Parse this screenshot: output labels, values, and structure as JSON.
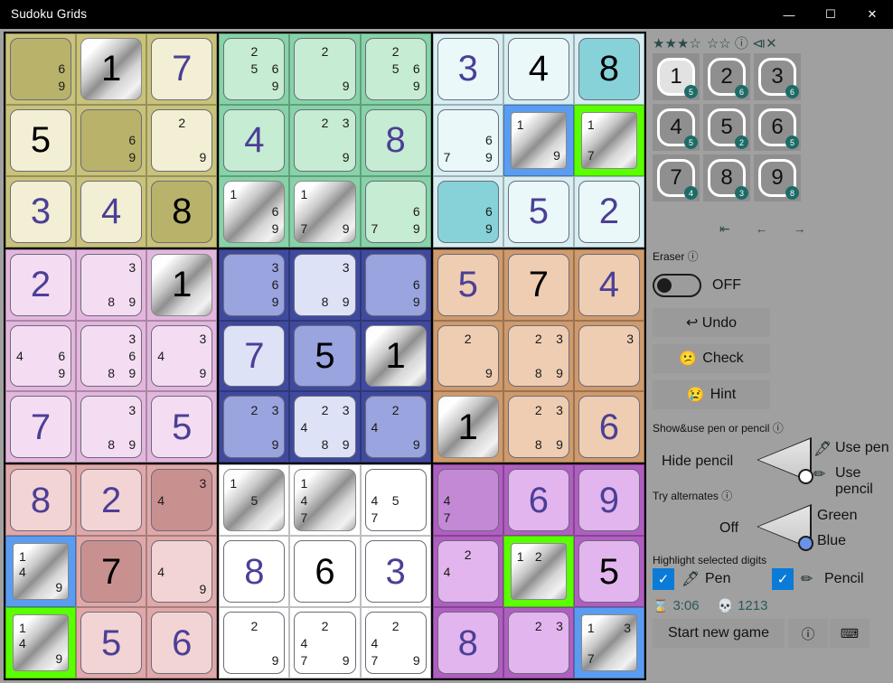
{
  "window": {
    "title": "Sudoku Grids",
    "minimize": "—",
    "maximize": "☐",
    "close": "✕"
  },
  "panel": {
    "rating": "★★★☆",
    "rating2": "☆☆",
    "info_icon": "ⓘ",
    "mute_icon": "⧏✕",
    "nav": "⇤ ← →",
    "eraser_label": "Eraser ⓘ",
    "eraser_state": "OFF",
    "undo_label": "↩ Undo",
    "check_label": "Check",
    "check_icon": "😕",
    "hint_label": "Hint",
    "hint_icon": "😢",
    "pen_section_label": "Show&use pen or pencil ⓘ",
    "hide_pencil_label": "Hide pencil",
    "use_pen_label": "Use pen",
    "use_pencil_label": "Use pencil",
    "pen_icon": "🖋",
    "pencil_icon": "✏",
    "alternates_label": "Try alternates ⓘ",
    "alt_off_label": "Off",
    "alt_green_label": "Green",
    "alt_blue_label": "Blue",
    "highlight_label": "Highlight selected digits",
    "check_mark": "✓",
    "hl_pen_label": "Pen",
    "hl_pencil_label": "Pencil",
    "timer_icon": "⌛",
    "timer_value": "3:06",
    "score_icon": "💀",
    "score_value": "1213",
    "new_game_label": "Start new game",
    "info2_icon": "ⓘ",
    "keyboard_icon": "⌨",
    "numpad": [
      {
        "digit": "1",
        "count": "5",
        "active": true
      },
      {
        "digit": "2",
        "count": "6",
        "active": false
      },
      {
        "digit": "3",
        "count": "6",
        "active": false
      },
      {
        "digit": "4",
        "count": "5",
        "active": false
      },
      {
        "digit": "5",
        "count": "2",
        "active": false
      },
      {
        "digit": "6",
        "count": "5",
        "active": false
      },
      {
        "digit": "7",
        "count": "4",
        "active": false
      },
      {
        "digit": "8",
        "count": "3",
        "active": false
      },
      {
        "digit": "9",
        "count": "8",
        "active": false
      }
    ]
  },
  "board": {
    "block_colors": [
      {
        "bg": "#c9c27a",
        "cell": "#f2efd4",
        "dark": "#b9b26a"
      },
      {
        "bg": "#86d3a8",
        "cell": "#c6ecd3",
        "dark": "#6cc292"
      },
      {
        "bg": "#d6eef2",
        "cell": "#eaf8fa",
        "dark": "#86d2d8"
      },
      {
        "bg": "#e3b6de",
        "cell": "#f4ddf2",
        "dark": "#d9a3d4"
      },
      {
        "bg": "#3f4a9e",
        "cell": "#dee2f7",
        "dark": "#9aa4de"
      },
      {
        "bg": "#cf9a6c",
        "cell": "#eecdb2",
        "dark": "#e3bb9c"
      },
      {
        "bg": "#e0a8a8",
        "cell": "#f3d4d4",
        "dark": "#c99090"
      },
      {
        "bg": "#ffffff",
        "cell": "#ffffff",
        "dark": "#ececec"
      },
      {
        "bg": "#b05ec2",
        "cell": "#e3b5ee",
        "dark": "#c389d4"
      }
    ],
    "cells": [
      [
        {
          "pencil": [
            null,
            null,
            null,
            null,
            null,
            "6",
            null,
            null,
            "9"
          ],
          "shade": "dark"
        },
        {
          "value": "1",
          "style": "metal"
        },
        {
          "value": "7",
          "style": "pen"
        },
        {
          "value": "5",
          "style": "given"
        },
        {
          "pencil": [
            null,
            null,
            null,
            null,
            null,
            "6",
            null,
            null,
            "9"
          ],
          "shade": "dark"
        },
        {
          "pencil": [
            null,
            "2",
            null,
            null,
            null,
            null,
            null,
            null,
            "9"
          ]
        },
        {
          "value": "3",
          "style": "pen"
        },
        {
          "value": "4",
          "style": "pen"
        },
        {
          "value": "8",
          "style": "given",
          "shade": "dark"
        }
      ],
      [
        {
          "pencil": [
            null,
            "2",
            null,
            null,
            "5",
            "6",
            null,
            null,
            "9"
          ]
        },
        {
          "pencil": [
            null,
            "2",
            null,
            null,
            null,
            null,
            null,
            null,
            "9"
          ]
        },
        {
          "pencil": [
            null,
            "2",
            null,
            null,
            "5",
            "6",
            null,
            null,
            "9"
          ]
        },
        {
          "value": "4",
          "style": "pen"
        },
        {
          "pencil": [
            null,
            "2",
            "3",
            null,
            null,
            null,
            null,
            null,
            "9"
          ]
        },
        {
          "value": "8",
          "style": "pen"
        },
        {
          "pencil": [
            "1",
            null,
            null,
            null,
            null,
            "6",
            null,
            null,
            "9"
          ],
          "style": "metal"
        },
        {
          "pencil": [
            "1",
            null,
            null,
            null,
            null,
            null,
            "7",
            null,
            "9"
          ],
          "style": "metal"
        },
        {
          "pencil": [
            null,
            null,
            null,
            null,
            null,
            "6",
            null,
            "7",
            "9"
          ]
        }
      ],
      [
        {
          "value": "3",
          "style": "pen"
        },
        {
          "value": "4",
          "style": "given"
        },
        {
          "value": "8",
          "style": "pen"
        },
        {
          "pencil": [
            null,
            null,
            null,
            null,
            null,
            null,
            null,
            null,
            null
          ],
          "empty": true
        },
        {
          "pencil": [
            null,
            null,
            null,
            null,
            null,
            null,
            null,
            null,
            null
          ],
          "empty": true
        },
        {
          "pencil": [
            null,
            null,
            null,
            null,
            null,
            null,
            null,
            null,
            null
          ],
          "empty": true
        },
        {
          "pencil": [
            null,
            null,
            null,
            null,
            null,
            "6",
            null,
            null,
            "9"
          ],
          "shade": "dark"
        },
        {
          "value": "5",
          "style": "pen"
        },
        {
          "value": "2",
          "style": "pen"
        }
      ]
    ]
  },
  "grid": {
    "cells": [
      {
        "r": 0,
        "c": 0,
        "blk": 0,
        "pencil": {
          "6": "6",
          "9": "9"
        },
        "shade": "dark"
      },
      {
        "r": 0,
        "c": 1,
        "blk": 0,
        "value": "1",
        "style": "metal"
      },
      {
        "r": 0,
        "c": 2,
        "blk": 0,
        "value": "7",
        "style": "pen"
      },
      {
        "r": 0,
        "c": 3,
        "blk": 1,
        "pencil": {
          "2": "2",
          "5": "5",
          "6": "6",
          "9": "9"
        }
      },
      {
        "r": 0,
        "c": 4,
        "blk": 1,
        "pencil": {
          "2": "2",
          "9": "9"
        }
      },
      {
        "r": 0,
        "c": 5,
        "blk": 1,
        "pencil": {
          "2": "2",
          "5": "5",
          "6": "6",
          "9": "9"
        }
      },
      {
        "r": 0,
        "c": 6,
        "blk": 2,
        "value": "3",
        "style": "pen"
      },
      {
        "r": 0,
        "c": 7,
        "blk": 2,
        "value": "4",
        "style": "given"
      },
      {
        "r": 0,
        "c": 8,
        "blk": 2,
        "value": "8",
        "style": "given",
        "shade": "dark"
      },
      {
        "r": 1,
        "c": 0,
        "blk": 0,
        "value": "5",
        "style": "given"
      },
      {
        "r": 1,
        "c": 1,
        "blk": 0,
        "pencil": {
          "6": "6",
          "9": "9"
        },
        "shade": "dark"
      },
      {
        "r": 1,
        "c": 2,
        "blk": 0,
        "pencil": {
          "2": "2",
          "9": "9"
        }
      },
      {
        "r": 1,
        "c": 3,
        "blk": 1,
        "value": "4",
        "style": "pen"
      },
      {
        "r": 1,
        "c": 4,
        "blk": 1,
        "pencil": {
          "2": "2",
          "3": "3",
          "9": "9"
        }
      },
      {
        "r": 1,
        "c": 5,
        "blk": 1,
        "value": "8",
        "style": "pen"
      },
      {
        "r": 1,
        "c": 6,
        "blk": 2,
        "pencil": {
          "6": "6",
          "7": "7",
          "9": "9"
        }
      },
      {
        "r": 1,
        "c": 7,
        "blk": 2,
        "pencil": {
          "1": "1",
          "9": "9"
        },
        "style": "metal",
        "sel": "blue"
      },
      {
        "r": 1,
        "c": 8,
        "blk": 2,
        "pencil": {
          "1": "1",
          "7": "7"
        },
        "style": "metal",
        "sel": "green"
      },
      {
        "r": 2,
        "c": 0,
        "blk": 0,
        "value": "3",
        "style": "pen"
      },
      {
        "r": 2,
        "c": 1,
        "blk": 0,
        "value": "4",
        "style": "pen"
      },
      {
        "r": 2,
        "c": 2,
        "blk": 0,
        "value": "8",
        "style": "given",
        "shade": "dark"
      },
      {
        "r": 2,
        "c": 3,
        "blk": 1,
        "pencil": {
          "1": "1",
          "6": "6",
          "9": "9"
        },
        "style": "metal"
      },
      {
        "r": 2,
        "c": 4,
        "blk": 1,
        "pencil": {
          "1": "1",
          "7": "7",
          "9": "9"
        },
        "style": "metal"
      },
      {
        "r": 2,
        "c": 5,
        "blk": 1,
        "pencil": {
          "6": "6",
          "7": "7",
          "9": "9"
        }
      },
      {
        "r": 2,
        "c": 6,
        "blk": 2,
        "pencil": {
          "6": "6",
          "9": "9"
        },
        "shade": "dark"
      },
      {
        "r": 2,
        "c": 7,
        "blk": 2,
        "value": "5",
        "style": "pen"
      },
      {
        "r": 2,
        "c": 8,
        "blk": 2,
        "value": "2",
        "style": "pen"
      },
      {
        "r": 3,
        "c": 0,
        "blk": 3,
        "value": "2",
        "style": "pen"
      },
      {
        "r": 3,
        "c": 1,
        "blk": 3,
        "pencil": {
          "3": "3",
          "8": "8",
          "9": "9"
        }
      },
      {
        "r": 3,
        "c": 2,
        "blk": 3,
        "value": "1",
        "style": "metal"
      },
      {
        "r": 3,
        "c": 3,
        "blk": 4,
        "pencil": {
          "3": "3",
          "6": "6",
          "9": "9"
        },
        "shade": "dark"
      },
      {
        "r": 3,
        "c": 4,
        "blk": 4,
        "pencil": {
          "3": "3",
          "8": "8",
          "9": "9"
        }
      },
      {
        "r": 3,
        "c": 5,
        "blk": 4,
        "pencil": {
          "6": "6",
          "9": "9"
        },
        "shade": "dark"
      },
      {
        "r": 3,
        "c": 6,
        "blk": 5,
        "value": "5",
        "style": "pen"
      },
      {
        "r": 3,
        "c": 7,
        "blk": 5,
        "value": "7",
        "style": "given"
      },
      {
        "r": 3,
        "c": 8,
        "blk": 5,
        "value": "4",
        "style": "pen"
      },
      {
        "r": 4,
        "c": 0,
        "blk": 3,
        "pencil": {
          "4": "4",
          "6": "6",
          "9": "9"
        }
      },
      {
        "r": 4,
        "c": 1,
        "blk": 3,
        "pencil": {
          "3": "3",
          "6": "6",
          "8": "8",
          "9": "9"
        }
      },
      {
        "r": 4,
        "c": 2,
        "blk": 3,
        "pencil": {
          "3": "3",
          "4": "4",
          "9": "9"
        }
      },
      {
        "r": 4,
        "c": 3,
        "blk": 4,
        "value": "7",
        "style": "pen"
      },
      {
        "r": 4,
        "c": 4,
        "blk": 4,
        "value": "5",
        "style": "given",
        "shade": "dark"
      },
      {
        "r": 4,
        "c": 5,
        "blk": 4,
        "value": "1",
        "style": "metal"
      },
      {
        "r": 4,
        "c": 6,
        "blk": 5,
        "pencil": {
          "2": "2",
          "9": "9"
        }
      },
      {
        "r": 4,
        "c": 7,
        "blk": 5,
        "pencil": {
          "2": "2",
          "3": "3",
          "8": "8",
          "9": "9"
        }
      },
      {
        "r": 4,
        "c": 8,
        "blk": 5,
        "pencil": {
          "3": "3"
        }
      },
      {
        "r": 5,
        "c": 0,
        "blk": 3,
        "value": "7",
        "style": "pen"
      },
      {
        "r": 5,
        "c": 1,
        "blk": 3,
        "pencil": {
          "3": "3",
          "8": "8",
          "9": "9"
        }
      },
      {
        "r": 5,
        "c": 2,
        "blk": 3,
        "value": "5",
        "style": "pen"
      },
      {
        "r": 5,
        "c": 3,
        "blk": 4,
        "pencil": {
          "2": "2",
          "3": "3",
          "9": "9"
        },
        "shade": "dark"
      },
      {
        "r": 5,
        "c": 4,
        "blk": 4,
        "pencil": {
          "2": "2",
          "3": "3",
          "4": "4",
          "8": "8",
          "9": "9"
        }
      },
      {
        "r": 5,
        "c": 5,
        "blk": 4,
        "pencil": {
          "2": "2",
          "4": "4",
          "9": "9"
        },
        "shade": "dark"
      },
      {
        "r": 5,
        "c": 6,
        "blk": 5,
        "value": "1",
        "style": "metal"
      },
      {
        "r": 5,
        "c": 7,
        "blk": 5,
        "pencil": {
          "2": "2",
          "3": "3",
          "8": "8",
          "9": "9"
        }
      },
      {
        "r": 5,
        "c": 8,
        "blk": 5,
        "value": "6",
        "style": "pen"
      },
      {
        "r": 6,
        "c": 0,
        "blk": 6,
        "value": "8",
        "style": "pen"
      },
      {
        "r": 6,
        "c": 1,
        "blk": 6,
        "value": "2",
        "style": "pen"
      },
      {
        "r": 6,
        "c": 2,
        "blk": 6,
        "pencil": {
          "3": "3",
          "4": "4"
        },
        "shade": "dark"
      },
      {
        "r": 6,
        "c": 3,
        "blk": 7,
        "pencil": {
          "1": "1",
          "5": "5"
        },
        "style": "metal"
      },
      {
        "r": 6,
        "c": 4,
        "blk": 7,
        "pencil": {
          "1": "1",
          "4": "4",
          "7": "7"
        },
        "style": "metal"
      },
      {
        "r": 6,
        "c": 5,
        "blk": 7,
        "pencil": {
          "4": "4",
          "5": "5",
          "7": "7"
        }
      },
      {
        "r": 6,
        "c": 6,
        "blk": 8,
        "pencil": {
          "4": "4",
          "7": "7"
        },
        "shade": "dark"
      },
      {
        "r": 6,
        "c": 7,
        "blk": 8,
        "value": "6",
        "style": "pen"
      },
      {
        "r": 6,
        "c": 8,
        "blk": 8,
        "value": "9",
        "style": "pen"
      },
      {
        "r": 7,
        "c": 0,
        "blk": 6,
        "pencil": {
          "1": "1",
          "4": "4",
          "9": "9"
        },
        "style": "metal",
        "sel": "blue"
      },
      {
        "r": 7,
        "c": 1,
        "blk": 6,
        "value": "7",
        "style": "given",
        "shade": "dark"
      },
      {
        "r": 7,
        "c": 2,
        "blk": 6,
        "pencil": {
          "4": "4",
          "9": "9"
        }
      },
      {
        "r": 7,
        "c": 3,
        "blk": 7,
        "value": "8",
        "style": "pen"
      },
      {
        "r": 7,
        "c": 4,
        "blk": 7,
        "value": "6",
        "style": "given"
      },
      {
        "r": 7,
        "c": 5,
        "blk": 7,
        "value": "3",
        "style": "pen"
      },
      {
        "r": 7,
        "c": 6,
        "blk": 8,
        "pencil": {
          "2": "2",
          "4": "4"
        }
      },
      {
        "r": 7,
        "c": 7,
        "blk": 8,
        "pencil": {
          "1": "1",
          "2": "2"
        },
        "style": "metal",
        "sel": "green"
      },
      {
        "r": 7,
        "c": 8,
        "blk": 8,
        "value": "5",
        "style": "given"
      },
      {
        "r": 8,
        "c": 0,
        "blk": 6,
        "pencil": {
          "1": "1",
          "4": "4",
          "9": "9"
        },
        "style": "metal",
        "sel": "green"
      },
      {
        "r": 8,
        "c": 1,
        "blk": 6,
        "value": "5",
        "style": "pen"
      },
      {
        "r": 8,
        "c": 2,
        "blk": 6,
        "value": "6",
        "style": "pen"
      },
      {
        "r": 8,
        "c": 3,
        "blk": 7,
        "pencil": {
          "2": "2",
          "9": "9"
        }
      },
      {
        "r": 8,
        "c": 4,
        "blk": 7,
        "pencil": {
          "2": "2",
          "4": "4",
          "7": "7",
          "9": "9"
        }
      },
      {
        "r": 8,
        "c": 5,
        "blk": 7,
        "pencil": {
          "2": "2",
          "4": "4",
          "7": "7",
          "9": "9"
        }
      },
      {
        "r": 8,
        "c": 6,
        "blk": 8,
        "value": "8",
        "style": "pen"
      },
      {
        "r": 8,
        "c": 7,
        "blk": 8,
        "pencil": {
          "2": "2",
          "3": "3"
        }
      },
      {
        "r": 8,
        "c": 8,
        "blk": 8,
        "pencil": {
          "1": "1",
          "3": "3",
          "7": "7"
        },
        "style": "metal",
        "sel": "blue"
      }
    ]
  },
  "colors": {
    "pen_digit": "#4b3f96",
    "given_digit": "#000000",
    "accent_teal": "#1d6b66",
    "checkbox_blue": "#0a7bd6",
    "select_green": "#5aff00",
    "select_blue": "#5a9cf0"
  }
}
